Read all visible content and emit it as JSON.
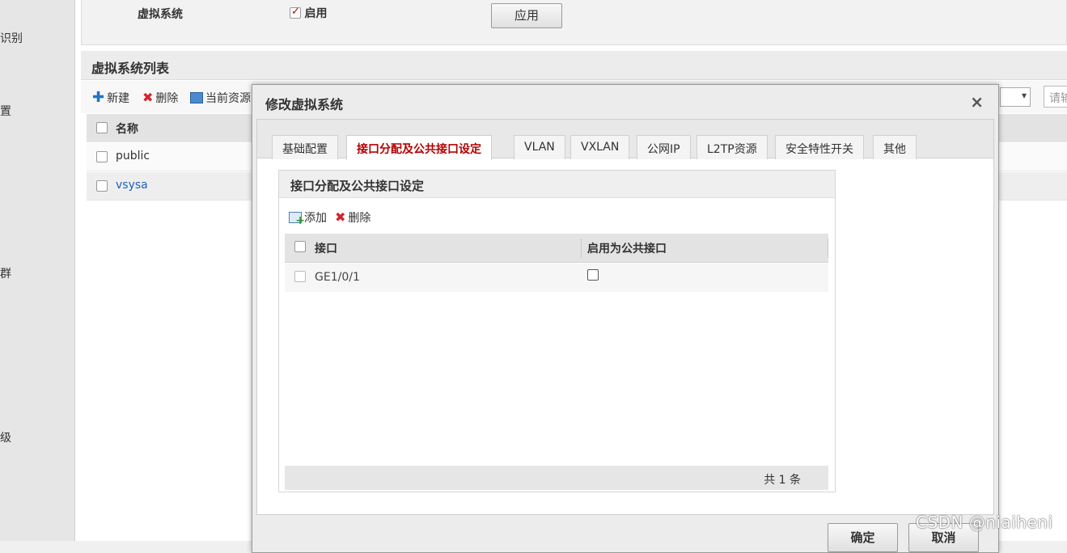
{
  "sidebar": {
    "items": [
      "识别",
      "置",
      "集群",
      "升级"
    ]
  },
  "settings": {
    "label": "虚拟系统",
    "enable_label": "启用",
    "apply_button": "应用"
  },
  "list": {
    "header": "虚拟系统列表",
    "toolbar": {
      "new": "新建",
      "delete": "删除",
      "current": "当前资源"
    },
    "columns": {
      "name": "名称"
    },
    "rows": [
      {
        "name": "public"
      },
      {
        "name": "vsysa"
      }
    ],
    "search_placeholder": "请输"
  },
  "dialog": {
    "title": "修改虚拟系统",
    "close": "×",
    "tabs": [
      {
        "label": "基础配置"
      },
      {
        "label": "接口分配及公共接口设定"
      },
      {
        "label": "VLAN"
      },
      {
        "label": "VXLAN"
      },
      {
        "label": "公网IP"
      },
      {
        "label": "L2TP资源"
      },
      {
        "label": "安全特性开关"
      },
      {
        "label": "其他"
      }
    ],
    "panel": {
      "title": "接口分配及公共接口设定",
      "add": "添加",
      "delete": "删除",
      "columns": {
        "interface": "接口",
        "public": "启用为公共接口"
      },
      "rows": [
        {
          "interface": "GE1/0/1"
        }
      ],
      "total": "共 1 条"
    },
    "ok_button": "确定",
    "cancel_button": "取消"
  },
  "watermark": "CSDN @niaiheni",
  "colors": {
    "active_tab": "#b30000",
    "link": "#1f5fbf",
    "accent_blue": "#1f74c7",
    "delete_red": "#d4222a"
  }
}
